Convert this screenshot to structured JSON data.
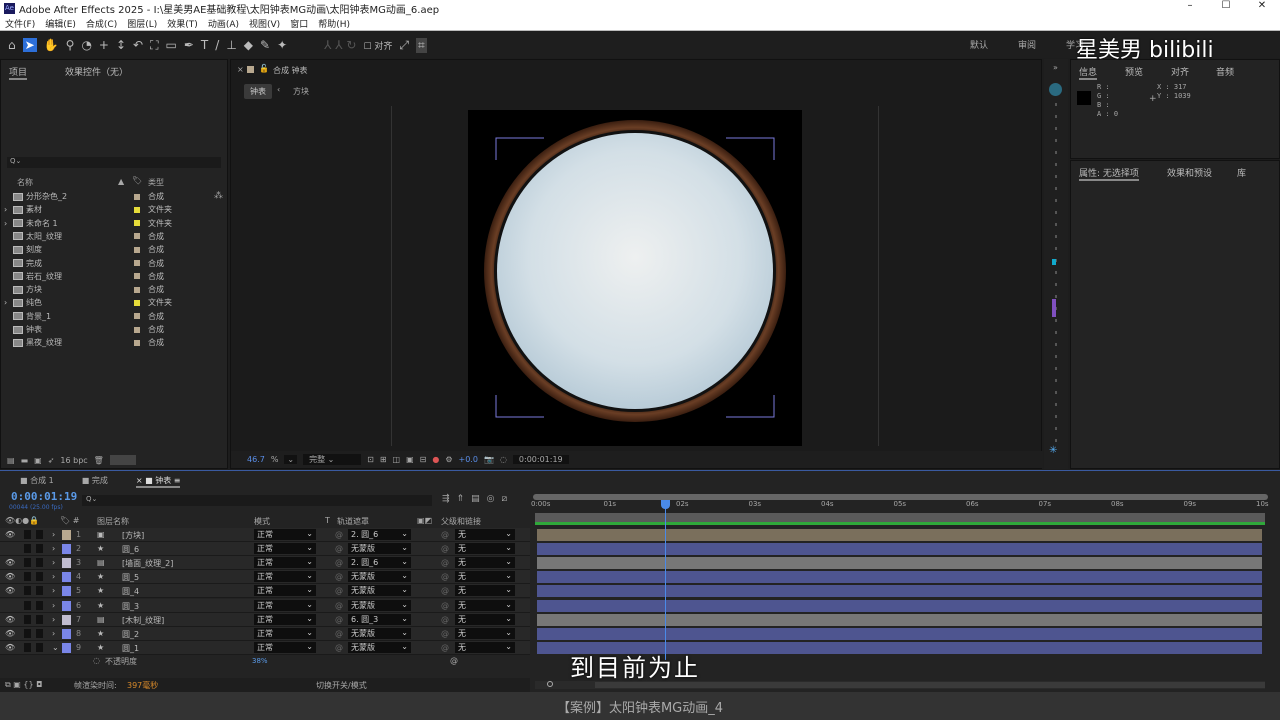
{
  "window": {
    "title": "Adobe After Effects 2025 - I:\\星美男AE基础教程\\太阳钟表MG动画\\太阳钟表MG动画_6.aep",
    "logo": "Ae",
    "controls": [
      "–",
      "☐",
      "✕"
    ]
  },
  "menu": [
    "文件(F)",
    "编辑(E)",
    "合成(C)",
    "图层(L)",
    "效果(T)",
    "动画(A)",
    "视图(V)",
    "窗口",
    "帮助(H)"
  ],
  "toolbar": {
    "snap_label": "对齐",
    "workspaces": [
      "默认",
      "审阅",
      "学习"
    ]
  },
  "watermark": "星美男  bilibili",
  "project_panel": {
    "tab": "项目",
    "tab2": "效果控件（无）",
    "search_placeholder": "Q⌄",
    "col_name": "名称",
    "col_type": "类型",
    "bpc": "16 bpc",
    "items": [
      {
        "name": "分形杂色_2",
        "type": "合成",
        "color": "#b8a88f",
        "folder": false
      },
      {
        "name": "素材",
        "type": "文件夹",
        "color": "#e6dc3a",
        "folder": true
      },
      {
        "name": "未命名 1",
        "type": "文件夹",
        "color": "#e6dc3a",
        "folder": true
      },
      {
        "name": "太阳_纹理",
        "type": "合成",
        "color": "#b8a88f",
        "folder": false
      },
      {
        "name": "刻度",
        "type": "合成",
        "color": "#b8a88f",
        "folder": false
      },
      {
        "name": "完成",
        "type": "合成",
        "color": "#b8a88f",
        "folder": false
      },
      {
        "name": "岩石_纹理",
        "type": "合成",
        "color": "#b8a88f",
        "folder": false
      },
      {
        "name": "方块",
        "type": "合成",
        "color": "#b8a88f",
        "folder": false
      },
      {
        "name": "纯色",
        "type": "文件夹",
        "color": "#e6dc3a",
        "folder": true
      },
      {
        "name": "背景_1",
        "type": "合成",
        "color": "#b8a88f",
        "folder": false
      },
      {
        "name": "钟表",
        "type": "合成",
        "color": "#b8a88f",
        "folder": false
      },
      {
        "name": "黑夜_纹理",
        "type": "合成",
        "color": "#b8a88f",
        "folder": false
      }
    ]
  },
  "comp_viewer": {
    "tab": "合成 钟表",
    "crumb1": "钟表",
    "crumb2": "方块",
    "zoom": "46.7",
    "resolution": "完整",
    "exposure": "+0.0",
    "timecode": "0:00:01:19"
  },
  "info_panel": {
    "tabs": [
      "信息",
      "预览",
      "对齐",
      "音频"
    ],
    "r": "R :",
    "g": "G :",
    "b": "B :",
    "a": "A : 0",
    "x": "X : 317",
    "y": "Y : 1039"
  },
  "properties_panel": {
    "tabs": [
      "属性: 无选择项",
      "效果和预设",
      "库"
    ]
  },
  "timeline": {
    "tabs": [
      "合成 1",
      "完成",
      "钟表"
    ],
    "timecode": "0:00:01:19",
    "frame_info": "00044 (25.00 fps)",
    "headers": {
      "name": "图层名称",
      "mode": "模式",
      "t": "T",
      "matte": "轨道遮罩",
      "parent": "父级和链接"
    },
    "ruler": [
      "0:00s",
      "01s",
      "02s",
      "03s",
      "04s",
      "05s",
      "06s",
      "07s",
      "08s",
      "09s",
      "10s"
    ],
    "playhead_seconds": 1.76,
    "layers": [
      {
        "num": "1",
        "name": "[方块]",
        "mode": "正常",
        "matte": "2. 圆_6",
        "parent": "无",
        "color": "#b8a88f",
        "vis": true,
        "bar": "#7a6f5c",
        "icon": "▣"
      },
      {
        "num": "2",
        "name": "圆_6",
        "mode": "正常",
        "matte": "无蒙版",
        "parent": "无",
        "color": "#7a86e8",
        "vis": false,
        "bar": "#4e5590",
        "icon": "★"
      },
      {
        "num": "3",
        "name": "[墙面_纹理_2]",
        "mode": "正常",
        "matte": "2. 圆_6",
        "parent": "无",
        "color": "#c0bcd0",
        "vis": true,
        "bar": "#777",
        "icon": "▤"
      },
      {
        "num": "4",
        "name": "圆_5",
        "mode": "正常",
        "matte": "无蒙版",
        "parent": "无",
        "color": "#7a86e8",
        "vis": true,
        "bar": "#4e5590",
        "icon": "★"
      },
      {
        "num": "5",
        "name": "圆_4",
        "mode": "正常",
        "matte": "无蒙版",
        "parent": "无",
        "color": "#7a86e8",
        "vis": true,
        "bar": "#4e5590",
        "icon": "★"
      },
      {
        "num": "6",
        "name": "圆_3",
        "mode": "正常",
        "matte": "无蒙版",
        "parent": "无",
        "color": "#7a86e8",
        "vis": false,
        "bar": "#4e5590",
        "icon": "★"
      },
      {
        "num": "7",
        "name": "[木制_纹理]",
        "mode": "正常",
        "matte": "6. 圆_3",
        "parent": "无",
        "color": "#c0bcd0",
        "vis": true,
        "bar": "#777",
        "icon": "▤"
      },
      {
        "num": "8",
        "name": "圆_2",
        "mode": "正常",
        "matte": "无蒙版",
        "parent": "无",
        "color": "#7a86e8",
        "vis": true,
        "bar": "#4e5590",
        "icon": "★"
      },
      {
        "num": "9",
        "name": "圆_1",
        "mode": "正常",
        "matte": "无蒙版",
        "parent": "无",
        "color": "#7a86e8",
        "vis": true,
        "bar": "#4e5590",
        "icon": "★"
      }
    ],
    "property": {
      "name": "不透明度",
      "value": "38%"
    },
    "render_label": "帧渲染时间:",
    "render_value": "397毫秒",
    "toggle_label": "切换开关/模式"
  },
  "subtitle": "到目前为止",
  "caption": "【案例】太阳钟表MG动画_4"
}
